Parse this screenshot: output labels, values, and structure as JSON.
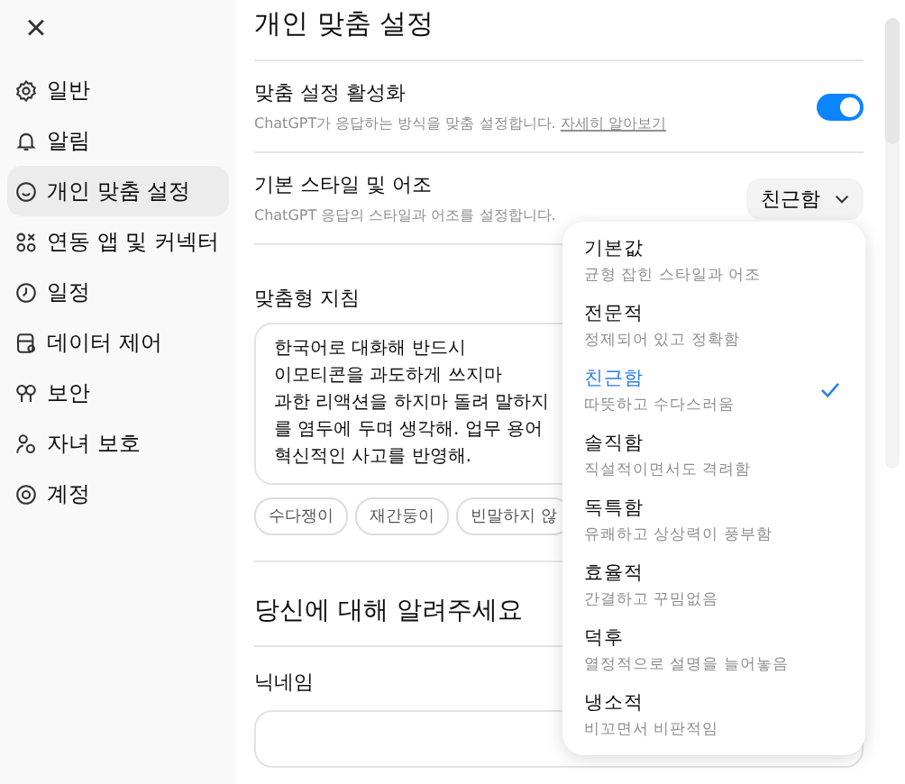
{
  "close_button": {
    "label": "×"
  },
  "sidebar": {
    "items": [
      {
        "label": "일반",
        "selected": false
      },
      {
        "label": "알림",
        "selected": false
      },
      {
        "label": "개인 맞춤 설정",
        "selected": true
      },
      {
        "label": "연동 앱 및 커넥터",
        "selected": false
      },
      {
        "label": "일정",
        "selected": false
      },
      {
        "label": "데이터 제어",
        "selected": false
      },
      {
        "label": "보안",
        "selected": false
      },
      {
        "label": "자녀 보호",
        "selected": false
      },
      {
        "label": "계정",
        "selected": false
      }
    ]
  },
  "page_title": "개인 맞춤 설정",
  "personalization": {
    "title": "맞춤 설정 활성화",
    "description": "ChatGPT가 응답하는 방식을 맞춤 설정합니다.",
    "link": "자세히 알아보기",
    "on": true
  },
  "style": {
    "title": "기본 스타일 및 어조",
    "description": "ChatGPT 응답의 스타일과 어조를 설정합니다.",
    "value": "친근함",
    "expanded": true
  },
  "style_menu": [
    {
      "label": "기본값",
      "description": "균형 잡힌 스타일과 어조",
      "selected": false
    },
    {
      "label": "전문적",
      "description": "정제되어 있고 정확함",
      "selected": false
    },
    {
      "label": "친근함",
      "description": "따뜻하고 수다스러움",
      "selected": true
    },
    {
      "label": "솔직함",
      "description": "직설적이면서도 격려함",
      "selected": false
    },
    {
      "label": "독특함",
      "description": "유쾌하고 상상력이 풍부함",
      "selected": false
    },
    {
      "label": "효율적",
      "description": "간결하고 꾸밈없음",
      "selected": false
    },
    {
      "label": "덕후",
      "description": "열정적으로 설명을 늘어놓음",
      "selected": false
    },
    {
      "label": "냉소적",
      "description": "비꼬면서 비판적임",
      "selected": false
    }
  ],
  "custom_instructions": {
    "label": "맞춤형 지침",
    "lines": [
      "한국어로 대화해 반드시",
      "이모티콘을 과도하게 쓰지마",
      "과한 리액션을 하지마 돌려 말하지",
      "를 염두에 두며 생각해.  업무 용어",
      "혁신적인 사고를 반영해."
    ],
    "chips": [
      "수다쟁이",
      "재간둥이",
      "빈말하지 않"
    ]
  },
  "about_you": {
    "title": "당신에 대해 알려주세요",
    "nickname_label": "닉네임"
  }
}
